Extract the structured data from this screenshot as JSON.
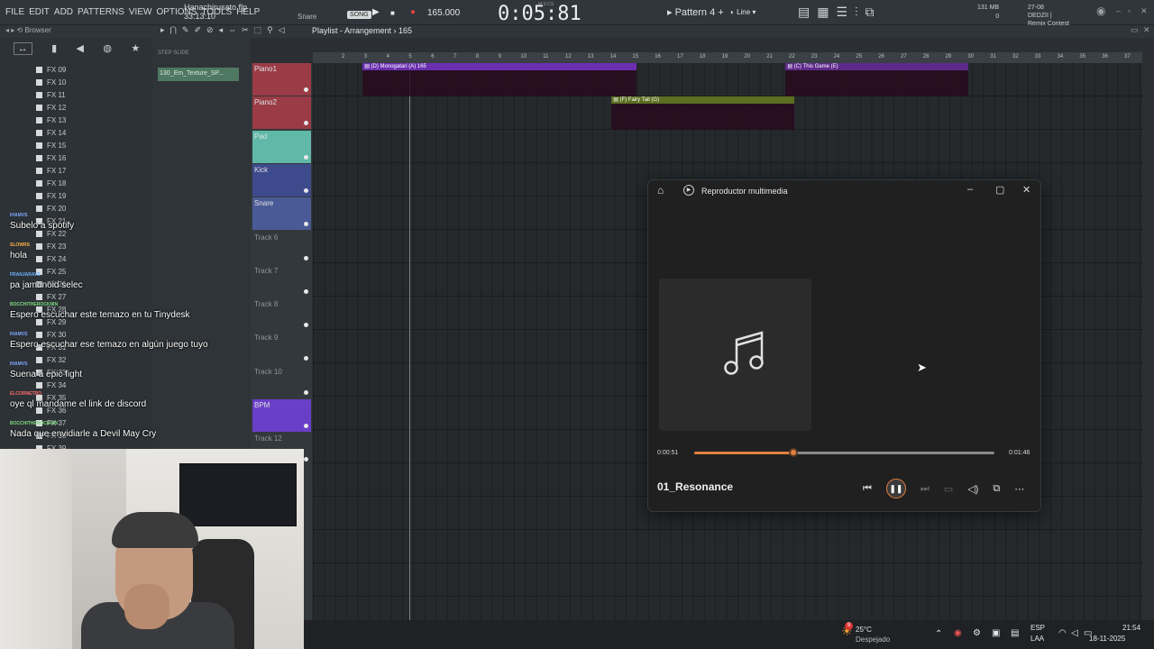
{
  "menu": [
    "FILE",
    "EDIT",
    "ADD",
    "PATTERNS",
    "VIEW",
    "OPTIONS",
    "TOOLS",
    "HELP"
  ],
  "project": {
    "file": "Hanachirusato.flp",
    "time": "33:13:10"
  },
  "transport": {
    "channel": "Snare",
    "song_label": "SONG",
    "tempo": "165.000",
    "time": "0:05:81",
    "mcs": "M:S:CS",
    "play": "▶",
    "stop": "■",
    "rec": "●"
  },
  "pattern": {
    "label": "Pattern 4",
    "snap": "Line"
  },
  "memory": {
    "mb": "131 MB",
    "count": "1",
    "zero": "0"
  },
  "news": {
    "date": "27-08",
    "user": "DEDZII |",
    "event": "Remix Contest"
  },
  "browser": {
    "label": "Browser"
  },
  "playlist": {
    "title": "Playlist - Arrangement",
    "bar": "165",
    "step": "STEP",
    "slide": "SLIDE"
  },
  "fx_items": [
    "FX 09",
    "FX 10",
    "FX 11",
    "FX 12",
    "FX 13",
    "FX 14",
    "FX 15",
    "FX 16",
    "FX 17",
    "FX 18",
    "FX 19",
    "FX 20",
    "FX 21",
    "FX 22",
    "FX 23",
    "FX 24",
    "FX 25",
    "FX 26",
    "FX 27",
    "FX 28",
    "FX 29",
    "FX 30",
    "FX 31",
    "FX 32",
    "FX 33",
    "FX 34",
    "FX 35",
    "FX 36",
    "FX 37",
    "FX 38",
    "FX 39"
  ],
  "channel_clip": "130_Em_Texture_SP...",
  "tracks": [
    {
      "name": "Piano1",
      "color": "#9a3b45"
    },
    {
      "name": "Piano2",
      "color": "#9a3b45"
    },
    {
      "name": "Pad",
      "color": "#5fb8a8"
    },
    {
      "name": "Kick",
      "color": "#3d4a8c"
    },
    {
      "name": "Snare",
      "color": "#4a5a96"
    },
    {
      "name": "Track 6",
      "color": ""
    },
    {
      "name": "Track 7",
      "color": ""
    },
    {
      "name": "Track 8",
      "color": ""
    },
    {
      "name": "Track 9",
      "color": ""
    },
    {
      "name": "Track 10",
      "color": ""
    },
    {
      "name": "BPM",
      "color": "#6a3fc7"
    },
    {
      "name": "Track 12",
      "color": ""
    }
  ],
  "ruler": [
    "2",
    "3",
    "4",
    "5",
    "6",
    "7",
    "8",
    "9",
    "10",
    "11",
    "12",
    "13",
    "14",
    "15",
    "16",
    "17",
    "18",
    "19",
    "20",
    "21",
    "22",
    "23",
    "24",
    "25",
    "26",
    "27",
    "28",
    "29",
    "30",
    "31",
    "32",
    "33",
    "34",
    "35",
    "36",
    "37"
  ],
  "clips": [
    {
      "label": "(D) Monogatari (A) 165",
      "color": "#6b2fb0",
      "track": 0,
      "start": 0.06,
      "len": 0.33
    },
    {
      "label": "(C) This Game (E)",
      "color": "#5e2a8c",
      "track": 0,
      "start": 0.57,
      "len": 0.22
    },
    {
      "label": "(F) Fairy Tail (G)",
      "color": "#5c6e21",
      "track": 1,
      "start": 0.36,
      "len": 0.22
    }
  ],
  "chat": [
    {
      "user": "IHAMVS",
      "color": "#7ea6ff",
      "text": "Subelo a spotify"
    },
    {
      "user": "SLOWRS",
      "color": "#ffb14a",
      "text": "hola"
    },
    {
      "user": "FRANJARAYS",
      "color": "#6db3ff",
      "text": "pa jamonoid selec"
    },
    {
      "user": "BOCCHITHEROCKNIN",
      "color": "#7ddc7d",
      "text": "Espero escuchar este temazo en tu Tinydesk"
    },
    {
      "user": "IHAMVS",
      "color": "#7ea6ff",
      "text": "Espero escuchar ese temazo en algún juego tuyo"
    },
    {
      "user": "IHAMVS",
      "color": "#7ea6ff",
      "text": "Suena a epic fight"
    },
    {
      "user": "ELCORNETRO",
      "color": "#ff6b6b",
      "text": "oye ql mandame el link de discord"
    },
    {
      "user": "BOCCHITHEROCKNIN",
      "color": "#7ddc7d",
      "text": "Nada que envidiarle a Devil May Cry"
    }
  ],
  "player": {
    "title": "Reproductor multimedia",
    "elapsed": "0:00:51",
    "total": "0:01:46",
    "progress": 0.33,
    "song": "01_Resonance",
    "accent": "#e3803d"
  },
  "taskbar": {
    "temp": "25°C",
    "weather": "Despejado",
    "lang": "ESP",
    "layout": "LAA",
    "time": "21:54",
    "date": "18-11-2025",
    "badge": "9"
  }
}
